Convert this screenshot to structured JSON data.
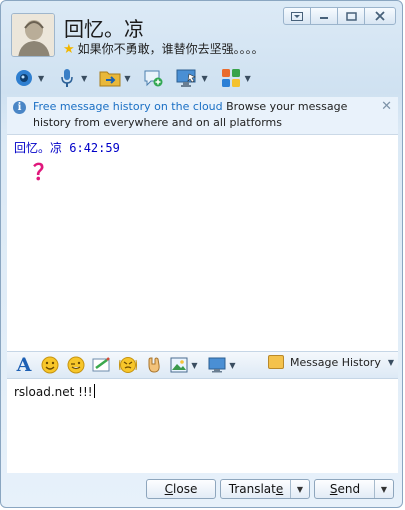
{
  "contact": {
    "name": "回忆。凉",
    "signature": "如果你不勇敢，谁替你去坚强。。。。"
  },
  "window_controls": {
    "icons": [
      "menu-icon",
      "minimize-icon",
      "maximize-icon",
      "close-icon"
    ]
  },
  "toolbar": {
    "items": [
      "webcam-icon",
      "microphone-icon",
      "file-transfer-icon",
      "add-chat-icon",
      "remote-desktop-icon",
      "apps-icon"
    ]
  },
  "info_bar": {
    "link": "Free message history on the cloud",
    "text": " Browse your message history from everywhere and on all platforms"
  },
  "history": {
    "sender": "回忆。凉",
    "time": "6:42:59",
    "message": "？"
  },
  "format_toolbar": {
    "items": [
      "font-icon",
      "emoticon-icon",
      "wink-icon",
      "scribble-icon",
      "nudge-icon",
      "gift-icon",
      "image-icon",
      "screenshot-icon"
    ],
    "message_history_label": "Message History"
  },
  "input": {
    "value": "rsload.net !!!"
  },
  "buttons": {
    "close_prefix": "",
    "close_underline": "C",
    "close_rest": "lose",
    "translate_prefix": "Translat",
    "translate_underline": "e",
    "translate_rest": "",
    "send_prefix": "",
    "send_underline": "S",
    "send_rest": "end"
  },
  "colors": {
    "accent": "#1a6fc4",
    "sender": "#0000c8",
    "message": "#e0177c"
  }
}
